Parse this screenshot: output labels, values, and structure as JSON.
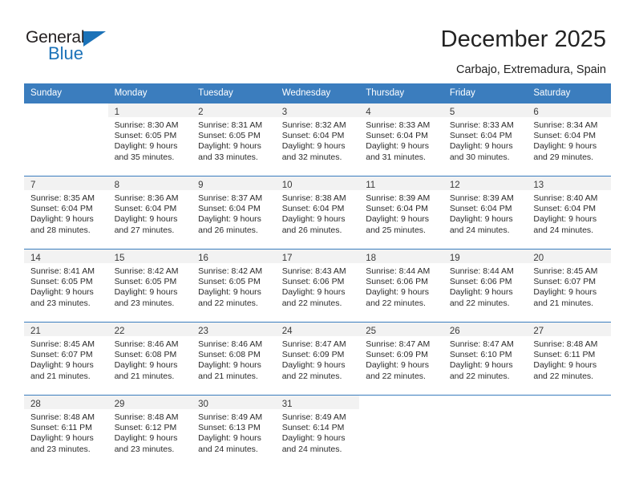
{
  "brand": {
    "name_top": "General",
    "name_bottom": "Blue",
    "accent_color": "#1b72b8",
    "triangle_icon": "triangle-icon"
  },
  "header": {
    "title": "December 2025",
    "subtitle": "Carbajo, Extremadura, Spain"
  },
  "calendar": {
    "header_bg": "#3b7dbe",
    "daynum_band_bg": "#f2f2f2",
    "weekday_headers": [
      "Sunday",
      "Monday",
      "Tuesday",
      "Wednesday",
      "Thursday",
      "Friday",
      "Saturday"
    ],
    "weeks": [
      [
        {
          "day": "",
          "sunrise": "",
          "sunset": "",
          "daylight_line1": "",
          "daylight_line2": ""
        },
        {
          "day": "1",
          "sunrise": "Sunrise: 8:30 AM",
          "sunset": "Sunset: 6:05 PM",
          "daylight_line1": "Daylight: 9 hours",
          "daylight_line2": "and 35 minutes."
        },
        {
          "day": "2",
          "sunrise": "Sunrise: 8:31 AM",
          "sunset": "Sunset: 6:05 PM",
          "daylight_line1": "Daylight: 9 hours",
          "daylight_line2": "and 33 minutes."
        },
        {
          "day": "3",
          "sunrise": "Sunrise: 8:32 AM",
          "sunset": "Sunset: 6:04 PM",
          "daylight_line1": "Daylight: 9 hours",
          "daylight_line2": "and 32 minutes."
        },
        {
          "day": "4",
          "sunrise": "Sunrise: 8:33 AM",
          "sunset": "Sunset: 6:04 PM",
          "daylight_line1": "Daylight: 9 hours",
          "daylight_line2": "and 31 minutes."
        },
        {
          "day": "5",
          "sunrise": "Sunrise: 8:33 AM",
          "sunset": "Sunset: 6:04 PM",
          "daylight_line1": "Daylight: 9 hours",
          "daylight_line2": "and 30 minutes."
        },
        {
          "day": "6",
          "sunrise": "Sunrise: 8:34 AM",
          "sunset": "Sunset: 6:04 PM",
          "daylight_line1": "Daylight: 9 hours",
          "daylight_line2": "and 29 minutes."
        }
      ],
      [
        {
          "day": "7",
          "sunrise": "Sunrise: 8:35 AM",
          "sunset": "Sunset: 6:04 PM",
          "daylight_line1": "Daylight: 9 hours",
          "daylight_line2": "and 28 minutes."
        },
        {
          "day": "8",
          "sunrise": "Sunrise: 8:36 AM",
          "sunset": "Sunset: 6:04 PM",
          "daylight_line1": "Daylight: 9 hours",
          "daylight_line2": "and 27 minutes."
        },
        {
          "day": "9",
          "sunrise": "Sunrise: 8:37 AM",
          "sunset": "Sunset: 6:04 PM",
          "daylight_line1": "Daylight: 9 hours",
          "daylight_line2": "and 26 minutes."
        },
        {
          "day": "10",
          "sunrise": "Sunrise: 8:38 AM",
          "sunset": "Sunset: 6:04 PM",
          "daylight_line1": "Daylight: 9 hours",
          "daylight_line2": "and 26 minutes."
        },
        {
          "day": "11",
          "sunrise": "Sunrise: 8:39 AM",
          "sunset": "Sunset: 6:04 PM",
          "daylight_line1": "Daylight: 9 hours",
          "daylight_line2": "and 25 minutes."
        },
        {
          "day": "12",
          "sunrise": "Sunrise: 8:39 AM",
          "sunset": "Sunset: 6:04 PM",
          "daylight_line1": "Daylight: 9 hours",
          "daylight_line2": "and 24 minutes."
        },
        {
          "day": "13",
          "sunrise": "Sunrise: 8:40 AM",
          "sunset": "Sunset: 6:04 PM",
          "daylight_line1": "Daylight: 9 hours",
          "daylight_line2": "and 24 minutes."
        }
      ],
      [
        {
          "day": "14",
          "sunrise": "Sunrise: 8:41 AM",
          "sunset": "Sunset: 6:05 PM",
          "daylight_line1": "Daylight: 9 hours",
          "daylight_line2": "and 23 minutes."
        },
        {
          "day": "15",
          "sunrise": "Sunrise: 8:42 AM",
          "sunset": "Sunset: 6:05 PM",
          "daylight_line1": "Daylight: 9 hours",
          "daylight_line2": "and 23 minutes."
        },
        {
          "day": "16",
          "sunrise": "Sunrise: 8:42 AM",
          "sunset": "Sunset: 6:05 PM",
          "daylight_line1": "Daylight: 9 hours",
          "daylight_line2": "and 22 minutes."
        },
        {
          "day": "17",
          "sunrise": "Sunrise: 8:43 AM",
          "sunset": "Sunset: 6:06 PM",
          "daylight_line1": "Daylight: 9 hours",
          "daylight_line2": "and 22 minutes."
        },
        {
          "day": "18",
          "sunrise": "Sunrise: 8:44 AM",
          "sunset": "Sunset: 6:06 PM",
          "daylight_line1": "Daylight: 9 hours",
          "daylight_line2": "and 22 minutes."
        },
        {
          "day": "19",
          "sunrise": "Sunrise: 8:44 AM",
          "sunset": "Sunset: 6:06 PM",
          "daylight_line1": "Daylight: 9 hours",
          "daylight_line2": "and 22 minutes."
        },
        {
          "day": "20",
          "sunrise": "Sunrise: 8:45 AM",
          "sunset": "Sunset: 6:07 PM",
          "daylight_line1": "Daylight: 9 hours",
          "daylight_line2": "and 21 minutes."
        }
      ],
      [
        {
          "day": "21",
          "sunrise": "Sunrise: 8:45 AM",
          "sunset": "Sunset: 6:07 PM",
          "daylight_line1": "Daylight: 9 hours",
          "daylight_line2": "and 21 minutes."
        },
        {
          "day": "22",
          "sunrise": "Sunrise: 8:46 AM",
          "sunset": "Sunset: 6:08 PM",
          "daylight_line1": "Daylight: 9 hours",
          "daylight_line2": "and 21 minutes."
        },
        {
          "day": "23",
          "sunrise": "Sunrise: 8:46 AM",
          "sunset": "Sunset: 6:08 PM",
          "daylight_line1": "Daylight: 9 hours",
          "daylight_line2": "and 21 minutes."
        },
        {
          "day": "24",
          "sunrise": "Sunrise: 8:47 AM",
          "sunset": "Sunset: 6:09 PM",
          "daylight_line1": "Daylight: 9 hours",
          "daylight_line2": "and 22 minutes."
        },
        {
          "day": "25",
          "sunrise": "Sunrise: 8:47 AM",
          "sunset": "Sunset: 6:09 PM",
          "daylight_line1": "Daylight: 9 hours",
          "daylight_line2": "and 22 minutes."
        },
        {
          "day": "26",
          "sunrise": "Sunrise: 8:47 AM",
          "sunset": "Sunset: 6:10 PM",
          "daylight_line1": "Daylight: 9 hours",
          "daylight_line2": "and 22 minutes."
        },
        {
          "day": "27",
          "sunrise": "Sunrise: 8:48 AM",
          "sunset": "Sunset: 6:11 PM",
          "daylight_line1": "Daylight: 9 hours",
          "daylight_line2": "and 22 minutes."
        }
      ],
      [
        {
          "day": "28",
          "sunrise": "Sunrise: 8:48 AM",
          "sunset": "Sunset: 6:11 PM",
          "daylight_line1": "Daylight: 9 hours",
          "daylight_line2": "and 23 minutes."
        },
        {
          "day": "29",
          "sunrise": "Sunrise: 8:48 AM",
          "sunset": "Sunset: 6:12 PM",
          "daylight_line1": "Daylight: 9 hours",
          "daylight_line2": "and 23 minutes."
        },
        {
          "day": "30",
          "sunrise": "Sunrise: 8:49 AM",
          "sunset": "Sunset: 6:13 PM",
          "daylight_line1": "Daylight: 9 hours",
          "daylight_line2": "and 24 minutes."
        },
        {
          "day": "31",
          "sunrise": "Sunrise: 8:49 AM",
          "sunset": "Sunset: 6:14 PM",
          "daylight_line1": "Daylight: 9 hours",
          "daylight_line2": "and 24 minutes."
        },
        {
          "day": "",
          "sunrise": "",
          "sunset": "",
          "daylight_line1": "",
          "daylight_line2": ""
        },
        {
          "day": "",
          "sunrise": "",
          "sunset": "",
          "daylight_line1": "",
          "daylight_line2": ""
        },
        {
          "day": "",
          "sunrise": "",
          "sunset": "",
          "daylight_line1": "",
          "daylight_line2": ""
        }
      ]
    ]
  }
}
